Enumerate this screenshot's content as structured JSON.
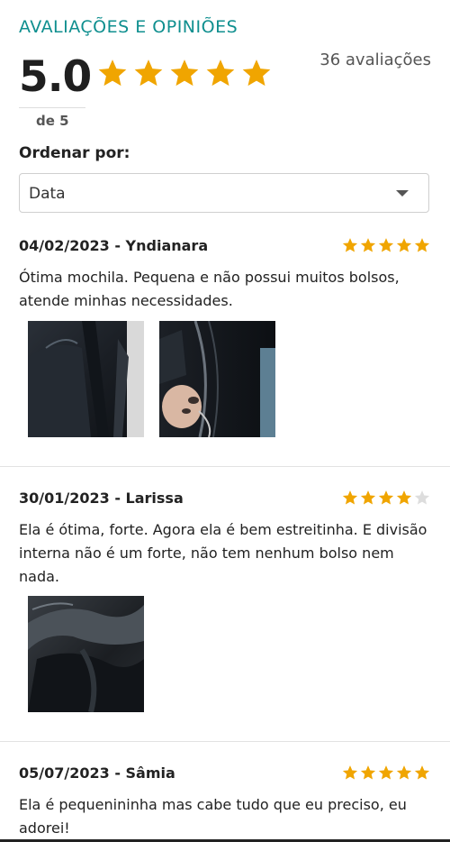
{
  "header": {
    "title": "AVALIAÇÕES E OPINIÕES",
    "score": "5.0",
    "scale": "de 5",
    "count": "36 avaliações",
    "rating": 5
  },
  "sort": {
    "label": "Ordenar por:",
    "value": "Data"
  },
  "colors": {
    "accent": "#0f8f8f",
    "star_filled": "#f0a500",
    "star_empty": "#dddddd"
  },
  "reviews": [
    {
      "header": "04/02/2023 - Yndianara",
      "rating": 5,
      "text": "Ótima mochila. Pequena e não possui muitos bolsos, atende minhas necessidades."
    },
    {
      "header": "30/01/2023 - Larissa",
      "rating": 4,
      "text": "Ela é ótima, forte. Agora ela é bem estreitinha. E divisão interna não é um forte, não tem nenhum bolso nem nada."
    },
    {
      "header": "05/07/2023 - Sâmia",
      "rating": 5,
      "text": "Ela é pequenininha mas cabe tudo que eu preciso, eu adorei!"
    }
  ]
}
